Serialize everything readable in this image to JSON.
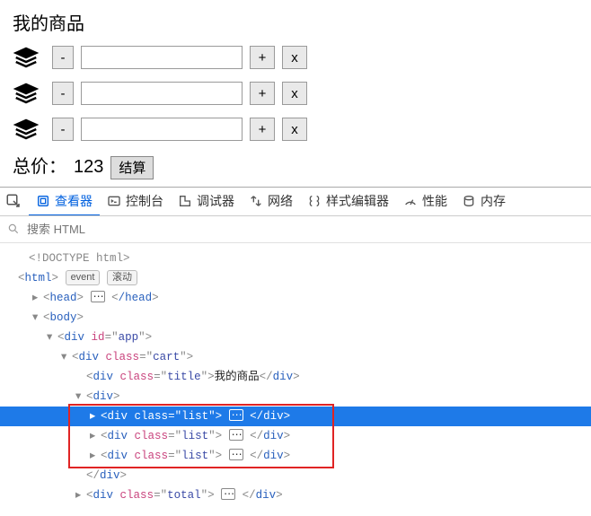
{
  "cart": {
    "title": "我的商品",
    "minus_label": "-",
    "plus_label": "+",
    "remove_label": "x",
    "rows": [
      {
        "value": ""
      },
      {
        "value": ""
      },
      {
        "value": ""
      }
    ],
    "total_label": "总价：",
    "total_value": "123",
    "settle_label": "结算"
  },
  "devtools": {
    "tabs": {
      "inspector": "查看器",
      "console": "控制台",
      "debugger": "调试器",
      "network": "网络",
      "style": "样式编辑器",
      "perf": "性能",
      "memory": "内存"
    },
    "search_placeholder": "搜索 HTML",
    "badges": {
      "event": "event",
      "scroll": "滚动"
    },
    "tree": {
      "doctype": "<!DOCTYPE html>",
      "html_open": "html",
      "head_open": "head",
      "head_close": "/head",
      "body_open": "body",
      "app_id": "app",
      "cart_class": "cart",
      "title_class": "title",
      "title_text": "我的商品",
      "list_class": "list",
      "total_class": "total"
    }
  }
}
